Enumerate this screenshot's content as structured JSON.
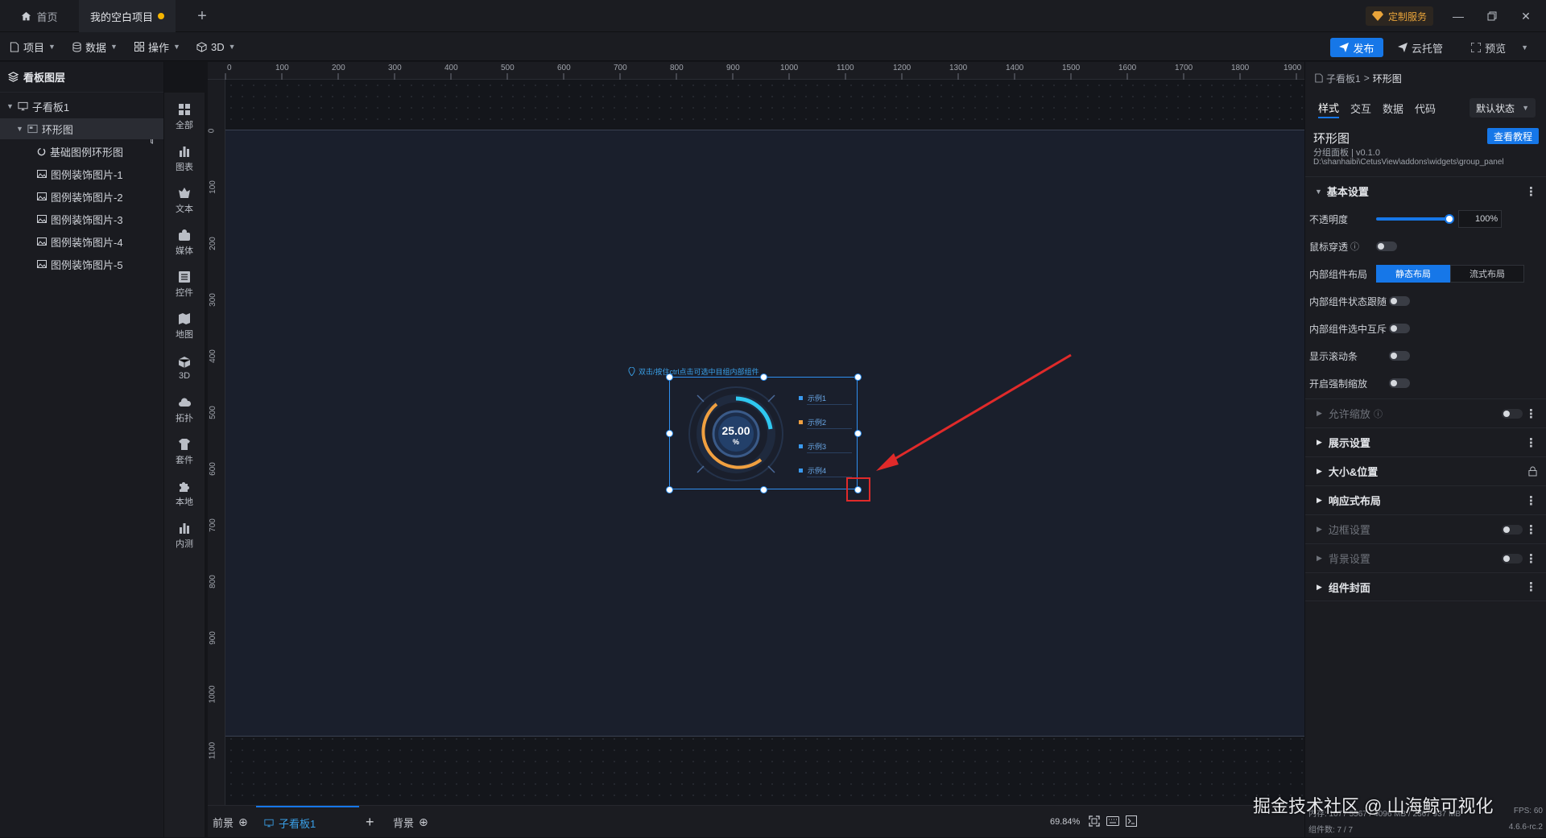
{
  "titlebar": {
    "tabs": [
      {
        "label": "首页"
      },
      {
        "label": "我的空白项目"
      }
    ],
    "custom_service": "定制服务",
    "window_buttons": [
      "minimize-icon",
      "restore-icon",
      "close-icon"
    ]
  },
  "menubar": {
    "items": [
      {
        "label": "项目",
        "icon": "document-icon"
      },
      {
        "label": "数据",
        "icon": "database-icon"
      },
      {
        "label": "操作",
        "icon": "grid-icon"
      },
      {
        "label": "3D",
        "icon": "cube-icon"
      }
    ],
    "publish": "发布",
    "cloud": "云托管",
    "preview": "预览"
  },
  "layers": {
    "title": "看板图层",
    "items": [
      {
        "label": "子看板1",
        "depth": 0
      },
      {
        "label": "环形图",
        "depth": 1
      },
      {
        "label": "基础图例环形图",
        "depth": 2
      },
      {
        "label": "图例装饰图片-1",
        "depth": 2
      },
      {
        "label": "图例装饰图片-2",
        "depth": 2
      },
      {
        "label": "图例装饰图片-3",
        "depth": 2
      },
      {
        "label": "图例装饰图片-4",
        "depth": 2
      },
      {
        "label": "图例装饰图片-5",
        "depth": 2
      }
    ]
  },
  "tools": [
    {
      "label": "全部",
      "icon": "grid-icon"
    },
    {
      "label": "图表",
      "icon": "bar-chart-icon"
    },
    {
      "label": "文本",
      "icon": "text-icon"
    },
    {
      "label": "媒体",
      "icon": "media-icon"
    },
    {
      "label": "控件",
      "icon": "control-icon"
    },
    {
      "label": "地图",
      "icon": "map-icon"
    },
    {
      "label": "3D",
      "icon": "cube-icon"
    },
    {
      "label": "拓扑",
      "icon": "cloud-icon"
    },
    {
      "label": "套件",
      "icon": "shirt-icon"
    },
    {
      "label": "本地",
      "icon": "puzzle-icon"
    },
    {
      "label": "内测",
      "icon": "bar-chart-icon"
    }
  ],
  "ruler": {
    "top": [
      "0",
      "100",
      "200",
      "300",
      "400",
      "500",
      "600",
      "700",
      "800",
      "900",
      "1000",
      "1100",
      "1200",
      "1300",
      "1400",
      "1500",
      "1600",
      "1700",
      "1800",
      "1900"
    ],
    "left": [
      "0",
      "100",
      "200",
      "300",
      "400",
      "500",
      "600",
      "700",
      "800",
      "900",
      "1000",
      "1100"
    ]
  },
  "widget": {
    "hint": "双击/按住ctrl点击可选中目组内部组件",
    "value": "25.00",
    "unit": "%",
    "legend": [
      "示例1",
      "示例2",
      "示例3",
      "示例4"
    ]
  },
  "bottombar": {
    "front": "前景",
    "board": "子看板1",
    "back": "背景",
    "zoom": "69.84%",
    "version": "4.6.6-rc.2",
    "component_count": "组件数: 7 / 7",
    "fps": "FPS: 60",
    "memory": "内存: 1077 5567 / 4096 MB / 2367 937 MB",
    "watermark": "掘金技术社区 @ 山海鲸可视化"
  },
  "rpanel": {
    "breadcrumb_parent": "子看板1",
    "breadcrumb_sep": ">",
    "breadcrumb_current": "环形图",
    "tabs": [
      "样式",
      "交互",
      "数据",
      "代码"
    ],
    "state_select": "默认状态",
    "component_name": "环形图",
    "tutorial": "查看教程",
    "subtitle": "分组面板 | v0.1.0",
    "path": "D:\\shanhaibi\\CetusView\\addons\\widgets\\group_panel",
    "basic_section": "基本设置",
    "opacity_label": "不透明度",
    "opacity_value": "100",
    "opacity_unit": "%",
    "mouse_through": "鼠标穿透",
    "layout_label": "内部组件布局",
    "layout_static": "静态布局",
    "layout_flow": "流式布局",
    "follow_state": "内部组件状态跟随",
    "mutex_select": "内部组件选中互斥",
    "show_scroll": "显示滚动条",
    "force_zoom": "开启强制缩放",
    "allow_zoom": "允许缩放",
    "sections": [
      "展示设置",
      "大小&位置",
      "响应式布局",
      "边框设置",
      "背景设置",
      "组件封面"
    ]
  },
  "colors": {
    "accent": "#1677e8",
    "ring_orange": "#f0a040",
    "ring_cyan": "#2fc8f0",
    "arrow": "#e02a2a"
  }
}
